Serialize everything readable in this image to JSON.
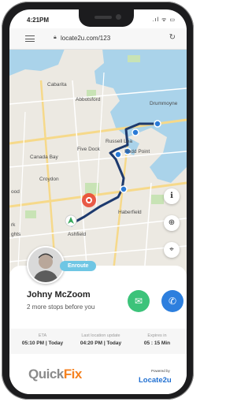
{
  "status": {
    "time": "4:21PM",
    "icons": ".ıl ᯤ ▭"
  },
  "browser": {
    "url": "locate2u.com/123"
  },
  "map": {
    "labels": {
      "cabarita": "Cabarita",
      "abbotsford": "Abbotsford",
      "drummoyne": "Drummoyne",
      "russell_lea": "Russell Lea",
      "five_dock": "Five Dock",
      "rodd_point": "Rodd Point",
      "canada_bay": "Canada Bay",
      "croydon": "Croydon",
      "wood": "ood",
      "haberfield": "Haberfield",
      "ashfield": "Ashfield",
      "rk": "rk",
      "ghts": "ghts"
    }
  },
  "driver": {
    "status_badge": "Enroute",
    "name": "Johny McZoom",
    "stops_text": "2 more stops before you"
  },
  "info": {
    "eta_label": "ETA",
    "eta_value": "05:10 PM | Today",
    "last_update_label": "Last location update",
    "last_update_value": "04:20 PM | Today",
    "expires_label": "Expires in",
    "expires_value": "05 : 15 Min"
  },
  "branding": {
    "quickfix_gray": "Quick",
    "quickfix_orange": "Fix",
    "powered_by": "Powered by",
    "locate2u": "Locate2u"
  },
  "icons": {
    "menu": "hamburger-icon",
    "lock": "lock-icon",
    "reload": "reload-icon",
    "info": "info-icon",
    "zoom": "zoom-in-icon",
    "locate": "location-target-icon",
    "message": "message-icon",
    "phone": "phone-icon"
  },
  "colors": {
    "route": "#1d3a6e",
    "route_start": "#2a7ad6",
    "destination_pin": "#e8412b",
    "enroute_badge": "#6fc6e4",
    "message_button": "#3cc37a",
    "call_button": "#2d7fde",
    "brand_orange": "#f58220",
    "brand_blue": "#1f6fd1",
    "water": "#aad3ea"
  }
}
